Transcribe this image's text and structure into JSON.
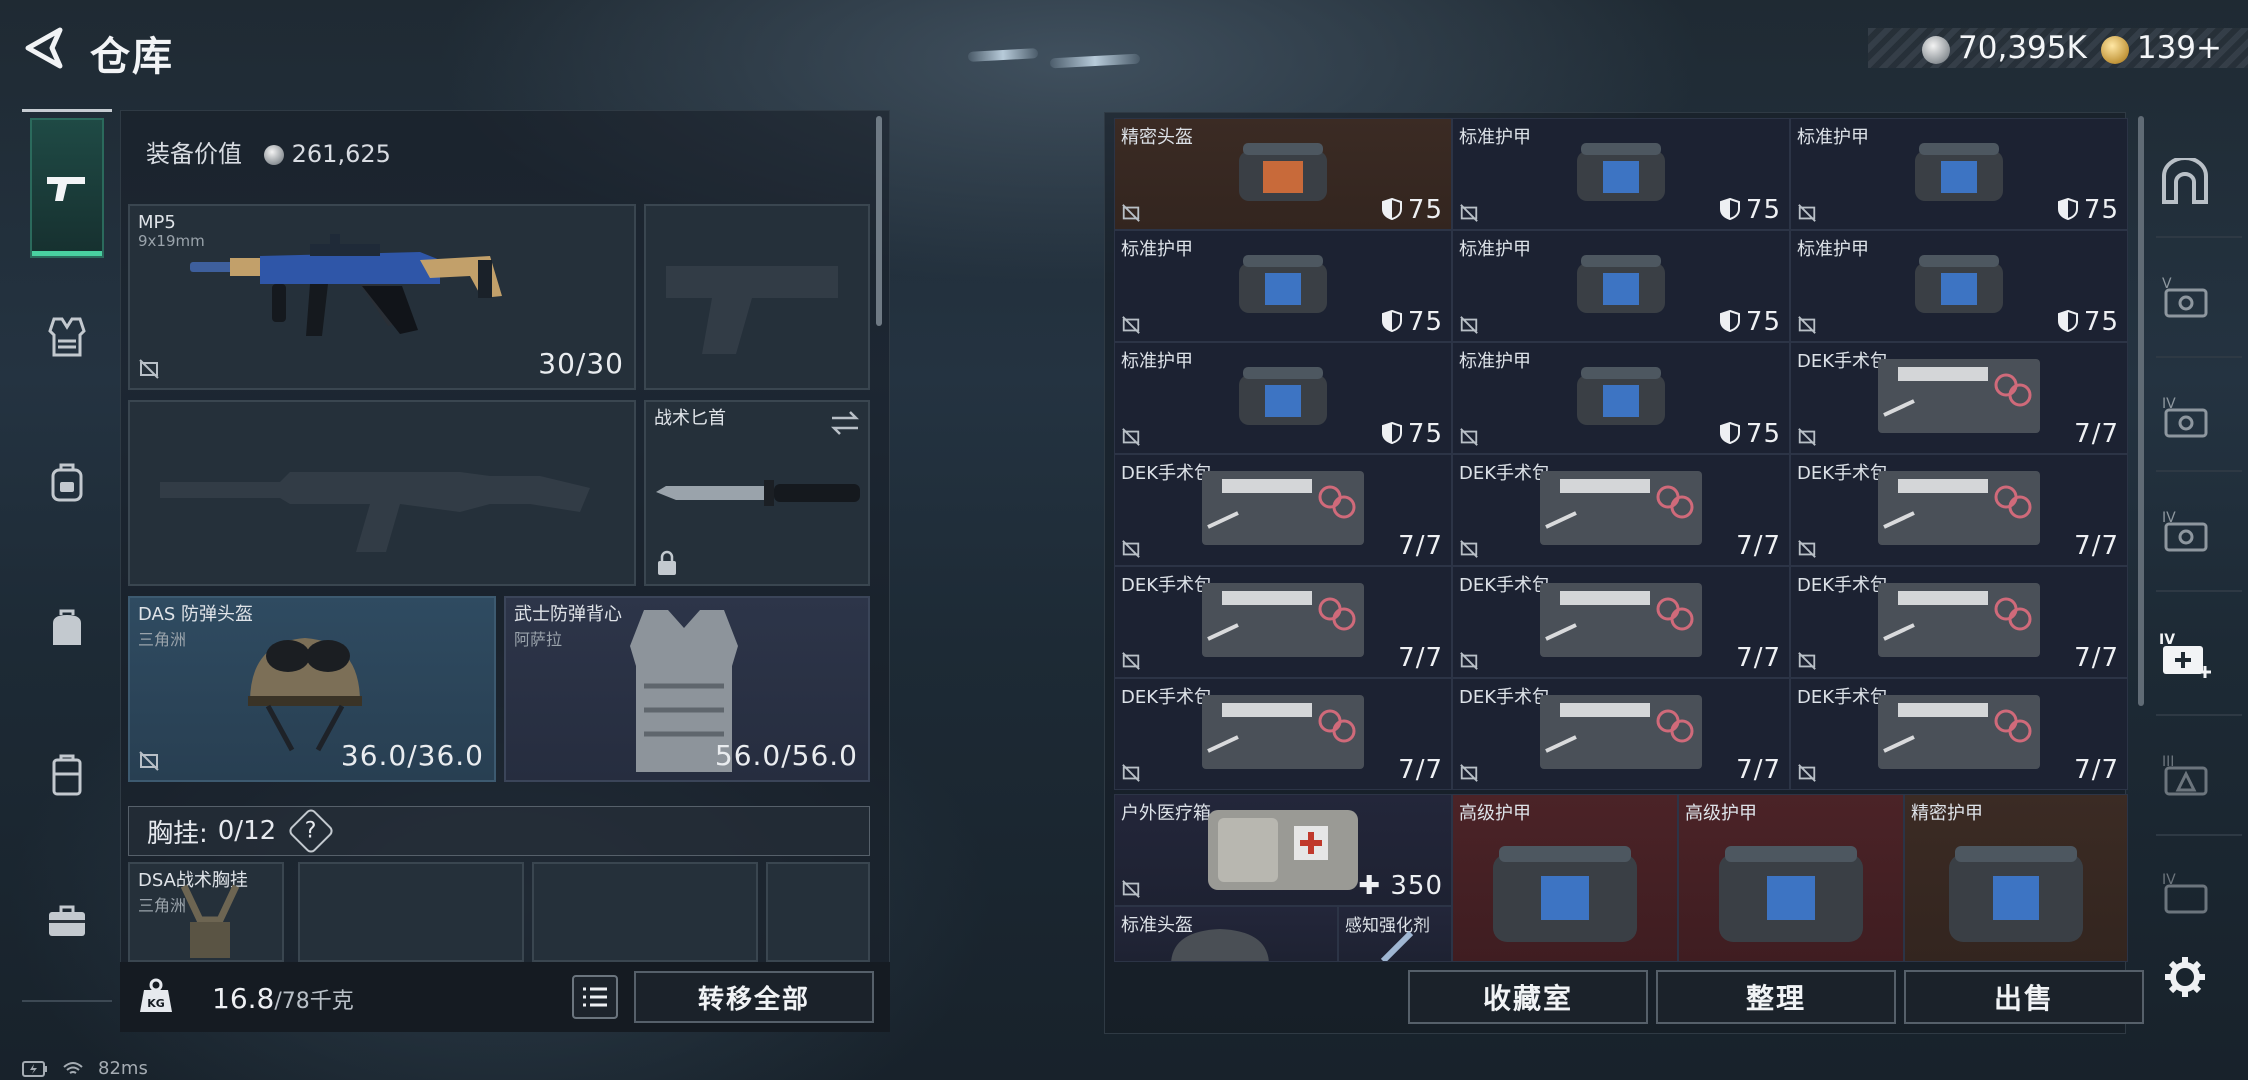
{
  "header": {
    "title": "仓库"
  },
  "currency": {
    "silver": "70,395K",
    "gold": "139+"
  },
  "left_nav": [
    {
      "name": "weapon",
      "active": true
    },
    {
      "name": "vest"
    },
    {
      "name": "backpack"
    },
    {
      "name": "bag"
    },
    {
      "name": "case"
    },
    {
      "name": "toolbox"
    }
  ],
  "equipment": {
    "value_label": "装备价值",
    "value": "261,625",
    "primary": {
      "name": "MP5",
      "caliber": "9x19mm",
      "ammo": "30/30"
    },
    "melee": {
      "name": "战术匕首"
    },
    "helmet": {
      "name": "DAS 防弹头盔",
      "origin": "三角洲",
      "durability": "36.0/36.0"
    },
    "armor": {
      "name": "武士防弹背心",
      "origin": "阿萨拉",
      "durability": "56.0/56.0"
    },
    "chest_rig": {
      "label": "胸挂:",
      "count": "0/12",
      "help": "?"
    },
    "chest_item": {
      "name": "DSA战术胸挂",
      "origin": "三角洲"
    }
  },
  "weight": {
    "current": "16.8",
    "max": "/78千克",
    "unit_icon": "KG"
  },
  "buttons": {
    "transfer_all": "转移全部",
    "collection": "收藏室",
    "sort": "整理",
    "sell": "出售"
  },
  "grid": [
    {
      "name": "精密头盔",
      "value": "75",
      "kind": "helmet",
      "bg": "brown"
    },
    {
      "name": "标准护甲",
      "value": "75",
      "kind": "armor",
      "bg": "navy"
    },
    {
      "name": "标准护甲",
      "value": "75",
      "kind": "armor",
      "bg": "navy"
    },
    {
      "name": "标准护甲",
      "value": "75",
      "kind": "armor",
      "bg": "navy"
    },
    {
      "name": "标准护甲",
      "value": "75",
      "kind": "armor",
      "bg": "navy"
    },
    {
      "name": "标准护甲",
      "value": "75",
      "kind": "armor",
      "bg": "navy"
    },
    {
      "name": "标准护甲",
      "value": "75",
      "kind": "armor",
      "bg": "navy"
    },
    {
      "name": "标准护甲",
      "value": "75",
      "kind": "armor",
      "bg": "navy"
    },
    {
      "name": "DEK手术包",
      "value": "7/7",
      "kind": "medkit",
      "bg": "navy"
    },
    {
      "name": "DEK手术包",
      "value": "7/7",
      "kind": "medkit",
      "bg": "navy"
    },
    {
      "name": "DEK手术包",
      "value": "7/7",
      "kind": "medkit",
      "bg": "navy"
    },
    {
      "name": "DEK手术包",
      "value": "7/7",
      "kind": "medkit",
      "bg": "navy"
    },
    {
      "name": "DEK手术包",
      "value": "7/7",
      "kind": "medkit",
      "bg": "navy"
    },
    {
      "name": "DEK手术包",
      "value": "7/7",
      "kind": "medkit",
      "bg": "navy"
    },
    {
      "name": "DEK手术包",
      "value": "7/7",
      "kind": "medkit",
      "bg": "navy"
    },
    {
      "name": "DEK手术包",
      "value": "7/7",
      "kind": "medkit",
      "bg": "navy"
    },
    {
      "name": "DEK手术包",
      "value": "7/7",
      "kind": "medkit",
      "bg": "navy"
    },
    {
      "name": "DEK手术包",
      "value": "7/7",
      "kind": "medkit",
      "bg": "navy"
    }
  ],
  "grid_bottom": {
    "outdoor_kit": {
      "name": "户外医疗箱",
      "value": "350"
    },
    "std_helmet": {
      "name": "标准头盔"
    },
    "stim": {
      "name": "感知强化剂"
    },
    "adv_armor_1": {
      "name": "高级护甲"
    },
    "adv_armor_2": {
      "name": "高级护甲"
    },
    "precise_armor": {
      "name": "精密护甲"
    }
  },
  "status_bar": {
    "ping": "82ms"
  }
}
